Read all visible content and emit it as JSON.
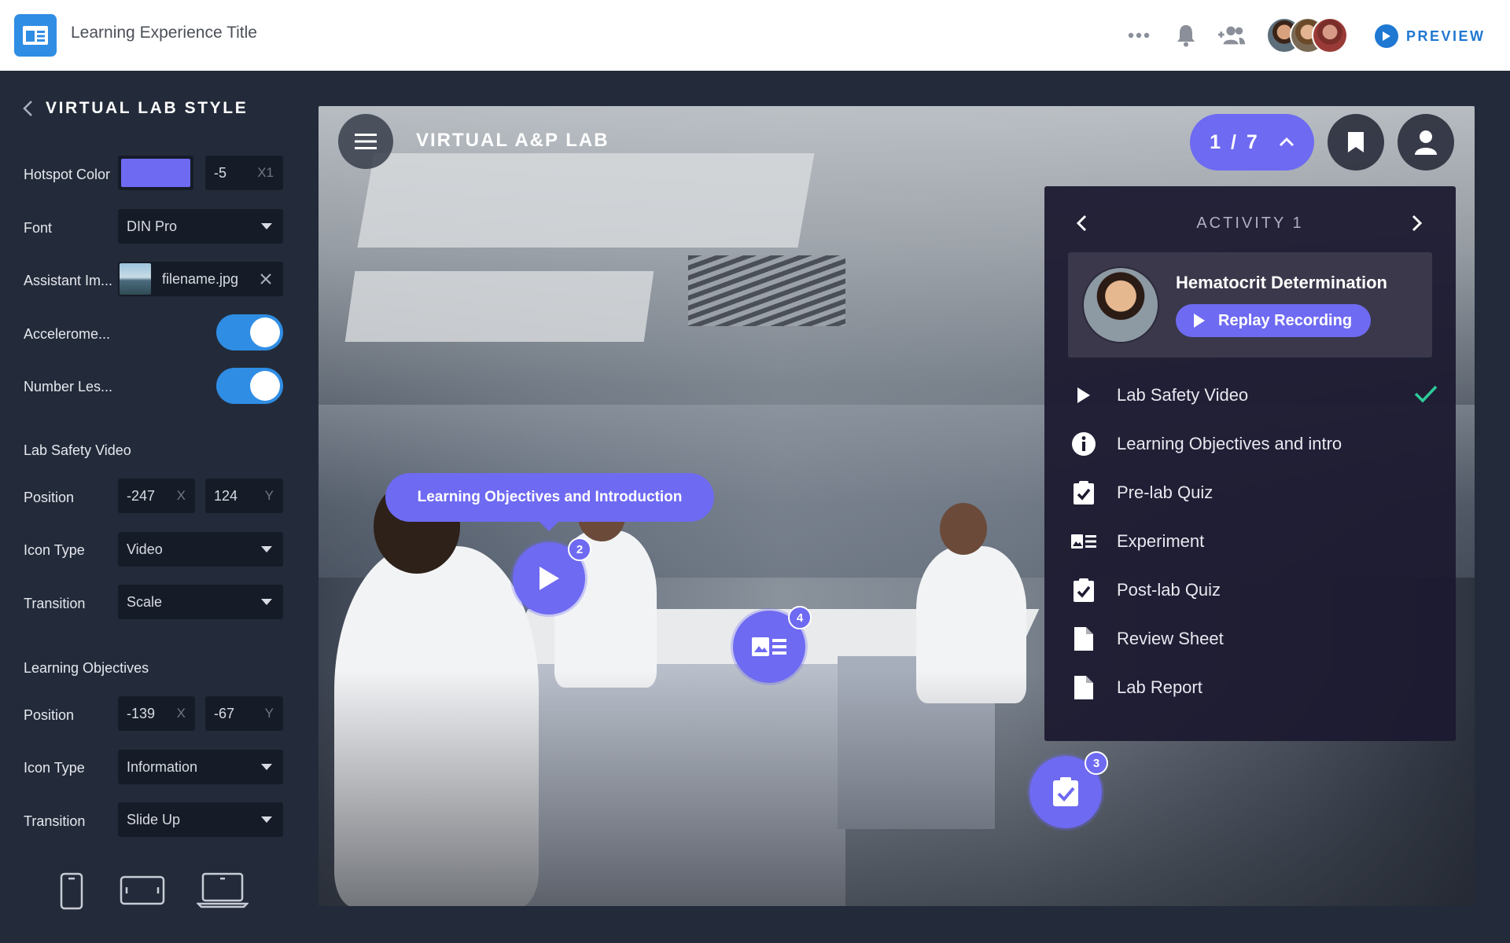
{
  "header": {
    "title": "Learning Experience Title",
    "preview_label": "PREVIEW",
    "icons": [
      "more-icon",
      "bell-icon",
      "add-user-icon"
    ],
    "accent": "#1f78d1"
  },
  "panel": {
    "title": "VIRTUAL LAB STYLE",
    "hotspot_color": {
      "label": "Hotspot Color",
      "swatch": "#6e6af2",
      "value": "-5",
      "unit": "X1"
    },
    "font": {
      "label": "Font",
      "value": "DIN Pro"
    },
    "assistant_image": {
      "label": "Assistant Im...",
      "file": "filename.jpg"
    },
    "accelerometer": {
      "label": "Accelerome...",
      "on": true
    },
    "number_lessons": {
      "label": "Number Les...",
      "on": true
    },
    "lab_safety": {
      "title": "Lab Safety Video",
      "position_label": "Position",
      "x": "-247",
      "x_unit": "X",
      "y": "124",
      "y_unit": "Y",
      "icon_type_label": "Icon Type",
      "icon_type": "Video",
      "transition_label": "Transition",
      "transition": "Scale"
    },
    "learning_objectives": {
      "title": "Learning Objectives",
      "position_label": "Position",
      "x": "-139",
      "x_unit": "X",
      "y": "-67",
      "y_unit": "Y",
      "icon_type_label": "Icon Type",
      "icon_type": "Information",
      "transition_label": "Transition",
      "transition": "Slide Up"
    },
    "devices": [
      "phone-icon",
      "tablet-icon",
      "laptop-icon"
    ]
  },
  "stage": {
    "title": "VIRTUAL A&P LAB",
    "pager": "1 / 7",
    "tooltip": "Learning Objectives and Introduction",
    "hotspots": [
      {
        "badge": "2",
        "icon": "play-icon"
      },
      {
        "badge": "4",
        "icon": "experiment-icon"
      },
      {
        "badge": "3",
        "icon": "quiz-icon"
      }
    ]
  },
  "activity": {
    "header": "ACTIVITY 1",
    "name": "Hematocrit Determination",
    "replay_label": "Replay Recording",
    "items": [
      {
        "label": "Lab Safety Video",
        "icon": "play-icon",
        "done": true
      },
      {
        "label": "Learning Objectives and intro",
        "icon": "info-icon"
      },
      {
        "label": "Pre-lab Quiz",
        "icon": "checklist-icon"
      },
      {
        "label": "Experiment",
        "icon": "experiment-icon"
      },
      {
        "label": "Post-lab Quiz",
        "icon": "checklist-icon"
      },
      {
        "label": "Review Sheet",
        "icon": "document-icon"
      },
      {
        "label": "Lab Report",
        "icon": "document-icon"
      }
    ],
    "check_color": "#2ecc9a"
  }
}
